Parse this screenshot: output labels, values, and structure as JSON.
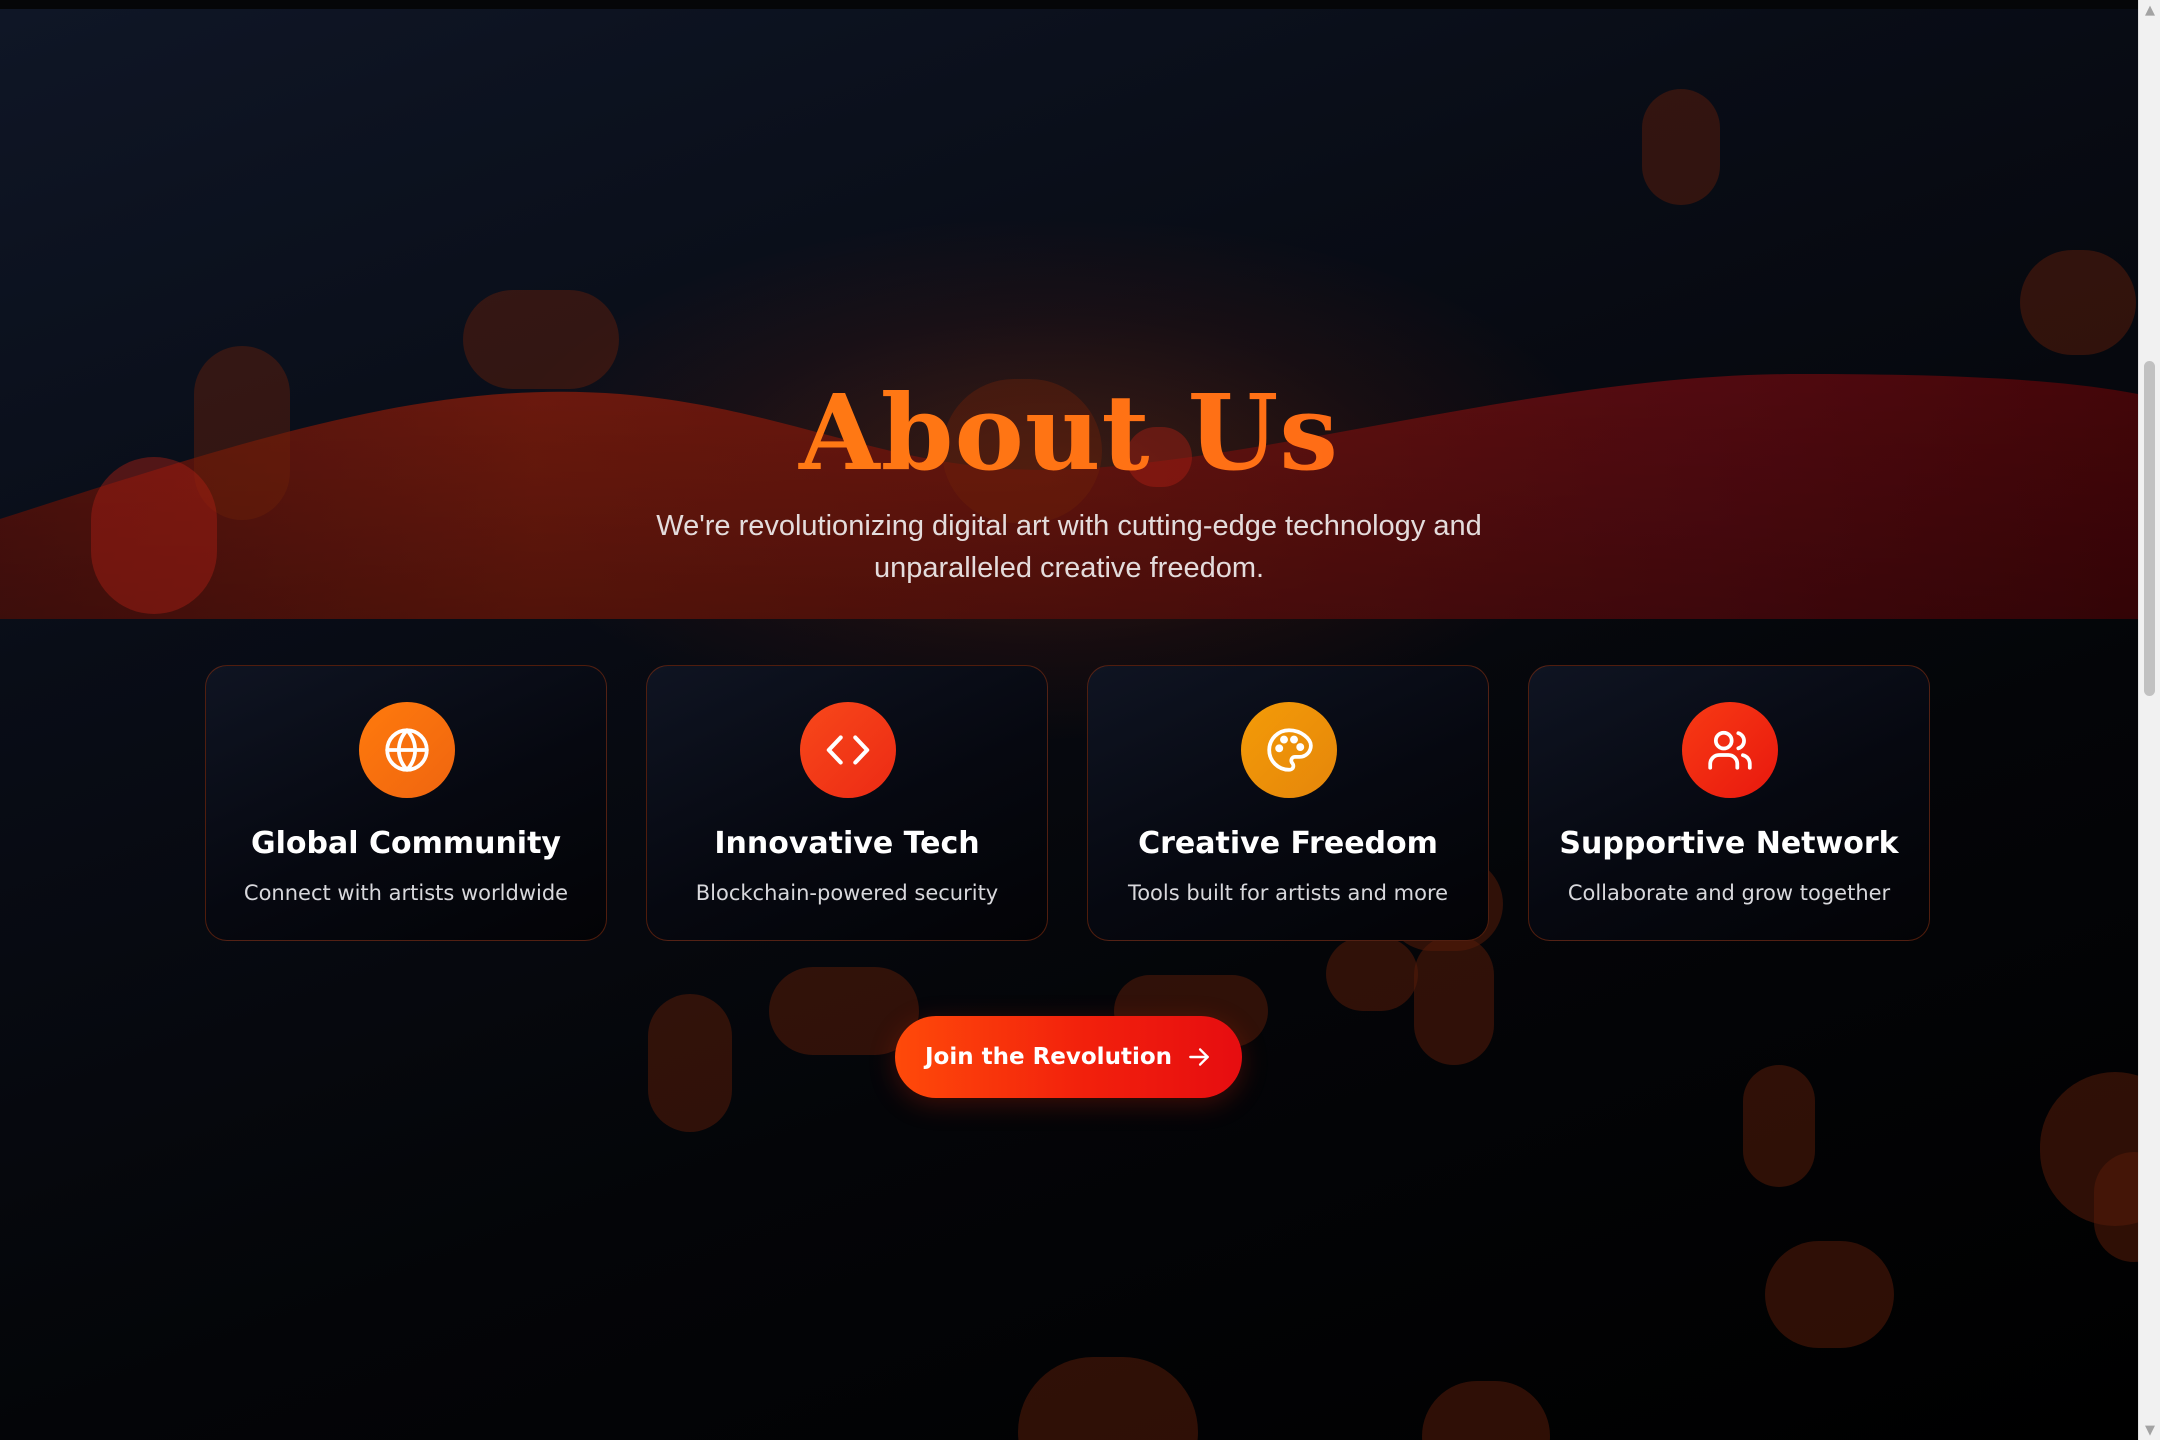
{
  "hero": {
    "title": "About Us",
    "subtitle": "We're revolutionizing digital art with cutting-edge technology and unparalleled creative freedom."
  },
  "features": [
    {
      "icon": "globe-icon",
      "title": "Global Community",
      "description": "Connect with artists worldwide",
      "color": "#f6730d"
    },
    {
      "icon": "code-icon",
      "title": "Innovative Tech",
      "description": "Blockchain-powered security",
      "color": "#f23c18"
    },
    {
      "icon": "palette-icon",
      "title": "Creative Freedom",
      "description": "Tools built for artists and more",
      "color": "#f0920a"
    },
    {
      "icon": "users-icon",
      "title": "Supportive Network",
      "description": "Collaborate and grow together",
      "color": "#f22a10"
    }
  ],
  "cta": {
    "label": "Join the Revolution",
    "icon": "arrow-right-icon"
  },
  "colors": {
    "accent_orange": "#ff7a12",
    "accent_red": "#e60d10",
    "background": "#05070d"
  }
}
